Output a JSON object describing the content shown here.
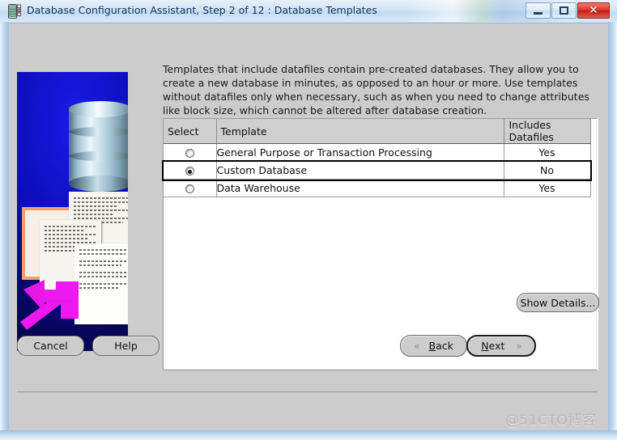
{
  "window": {
    "title": "Database Configuration Assistant, Step 2 of 12 : Database Templates",
    "icon": "database-app-icon",
    "minimize_label": "",
    "maximize_label": "",
    "close_label": "✕"
  },
  "description": "Templates that include datafiles contain pre-created databases. They allow you to create a new database in minutes, as opposed to an hour or more. Use templates without datafiles only when necessary, such as when you need to change attributes like block size, which cannot be altered after database creation.",
  "table": {
    "columns": [
      "Select",
      "Template",
      "Includes Datafiles"
    ],
    "rows": [
      {
        "selected": false,
        "template": "General Purpose or Transaction Processing",
        "includes_datafiles": "Yes"
      },
      {
        "selected": true,
        "template": "Custom Database",
        "includes_datafiles": "No"
      },
      {
        "selected": false,
        "template": "Data Warehouse",
        "includes_datafiles": "Yes"
      }
    ]
  },
  "buttons": {
    "show_details": "Show Details...",
    "cancel": "Cancel",
    "help": "Help",
    "back": "Back",
    "back_mnemonic": "B",
    "back_rest": "ack",
    "next": "Next",
    "next_mnemonic": "N",
    "next_rest": "ext",
    "back_chevron": "«",
    "next_chevron": "»"
  },
  "watermark": "@51CTO博客",
  "colors": {
    "selection_blue": "#0000ee",
    "panel_gray": "#cccccc",
    "illustration_blue": "#0d0db8",
    "arrow_magenta": "#ee19ee",
    "close_red": "#d9362a"
  }
}
